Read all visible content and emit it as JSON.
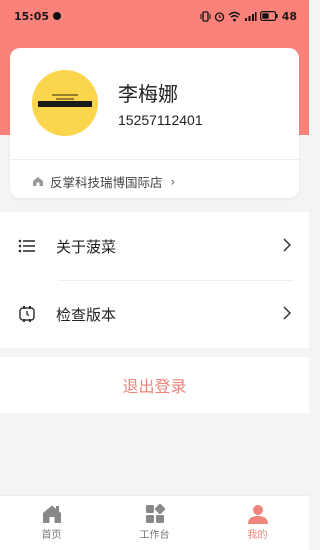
{
  "status_bar": {
    "time": "15:05",
    "battery": "48"
  },
  "profile": {
    "name": "李梅娜",
    "phone": "15257112401",
    "store": "反掌科技瑞博国际店"
  },
  "menu": {
    "items": [
      {
        "label": "关于菠菜",
        "icon": "list-icon"
      },
      {
        "label": "检查版本",
        "icon": "version-check-icon"
      }
    ]
  },
  "logout": {
    "label": "退出登录"
  },
  "tabbar": {
    "tabs": [
      {
        "label": "首页",
        "icon": "home-icon"
      },
      {
        "label": "工作台",
        "icon": "workbench-grid-icon"
      },
      {
        "label": "我的",
        "icon": "user-icon",
        "active": true
      }
    ]
  },
  "colors": {
    "header": "#fa827a",
    "accent": "#f0857c",
    "avatar": "#fbd54b",
    "background": "#f4f4f5"
  }
}
